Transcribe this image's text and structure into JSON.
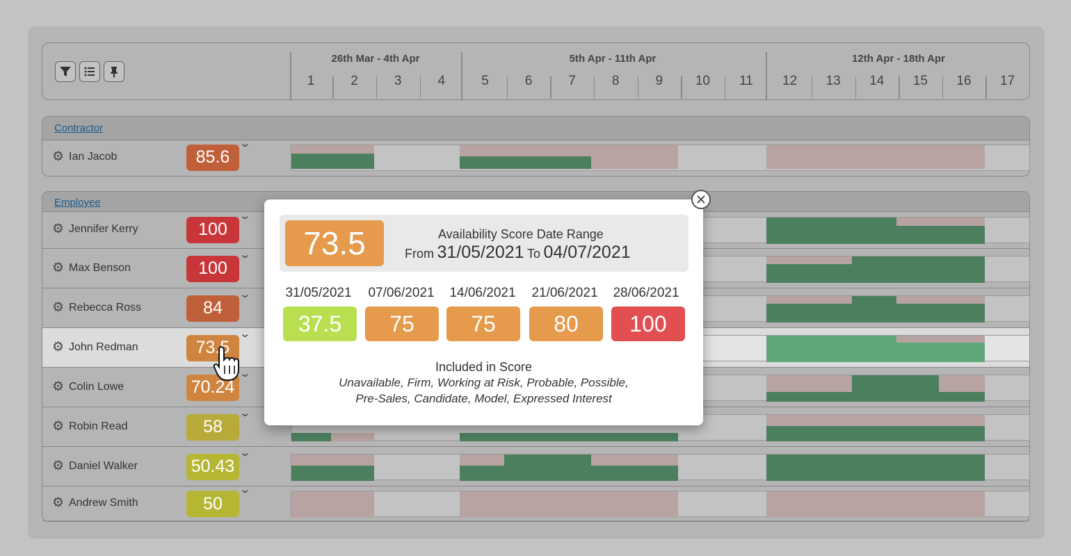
{
  "header": {
    "tools": [
      {
        "name": "filter-icon",
        "glyph": "▼"
      },
      {
        "name": "list-icon",
        "glyph": "☰"
      },
      {
        "name": "pin-icon",
        "glyph": "📌"
      }
    ],
    "ranges": [
      "26th Mar - 4th Apr",
      "5th Apr - 11th Apr",
      "12th Apr - 18th Apr"
    ],
    "days": [
      "1",
      "2",
      "3",
      "4",
      "5",
      "6",
      "7",
      "8",
      "9",
      "10",
      "11",
      "12",
      "13",
      "14",
      "15",
      "16",
      "17"
    ]
  },
  "groups": {
    "contractor": "Contractor",
    "employee": "Employee"
  },
  "rows": [
    {
      "name": "Ian Jacob",
      "score": "85.6",
      "color": "#c0603a"
    },
    {
      "name": "Jennifer Kerry",
      "score": "100",
      "color": "#c9363a"
    },
    {
      "name": "Max Benson",
      "score": "100",
      "color": "#c9363a"
    },
    {
      "name": "Rebecca Ross",
      "score": "84",
      "color": "#c0603a"
    },
    {
      "name": "John Redman",
      "score": "73.5",
      "color": "#cf8540"
    },
    {
      "name": "Colin Lowe",
      "score": "70.24",
      "color": "#cf8540"
    },
    {
      "name": "Robin Read",
      "score": "58",
      "color": "#b8aa38"
    },
    {
      "name": "Daniel Walker",
      "score": "50.43",
      "color": "#b5b734"
    },
    {
      "name": "Andrew Smith",
      "score": "50",
      "color": "#b5b734"
    }
  ],
  "popup": {
    "score": "73.5",
    "title": "Availability Score Date Range",
    "from_label": "From",
    "from_date": "31/05/2021",
    "to_label": "To",
    "to_date": "04/07/2021",
    "weeks": [
      {
        "date": "31/05/2021",
        "score": "37.5",
        "color": "#b8df4f"
      },
      {
        "date": "07/06/2021",
        "score": "75",
        "color": "#e59a4c"
      },
      {
        "date": "14/06/2021",
        "score": "75",
        "color": "#e59a4c"
      },
      {
        "date": "21/06/2021",
        "score": "80",
        "color": "#e59a4c"
      },
      {
        "date": "28/06/2021",
        "score": "100",
        "color": "#e14f51"
      }
    ],
    "included_title": "Included in Score",
    "included_line1": "Unavailable, Firm, Working at Risk, Probable, Possible,",
    "included_line2": "Pre-Sales, Candidate, Model, Expressed Interest"
  },
  "colors": {
    "pink": "#b7a3a1",
    "green": "#4c7f5e",
    "green_light": "#5fa77a"
  }
}
